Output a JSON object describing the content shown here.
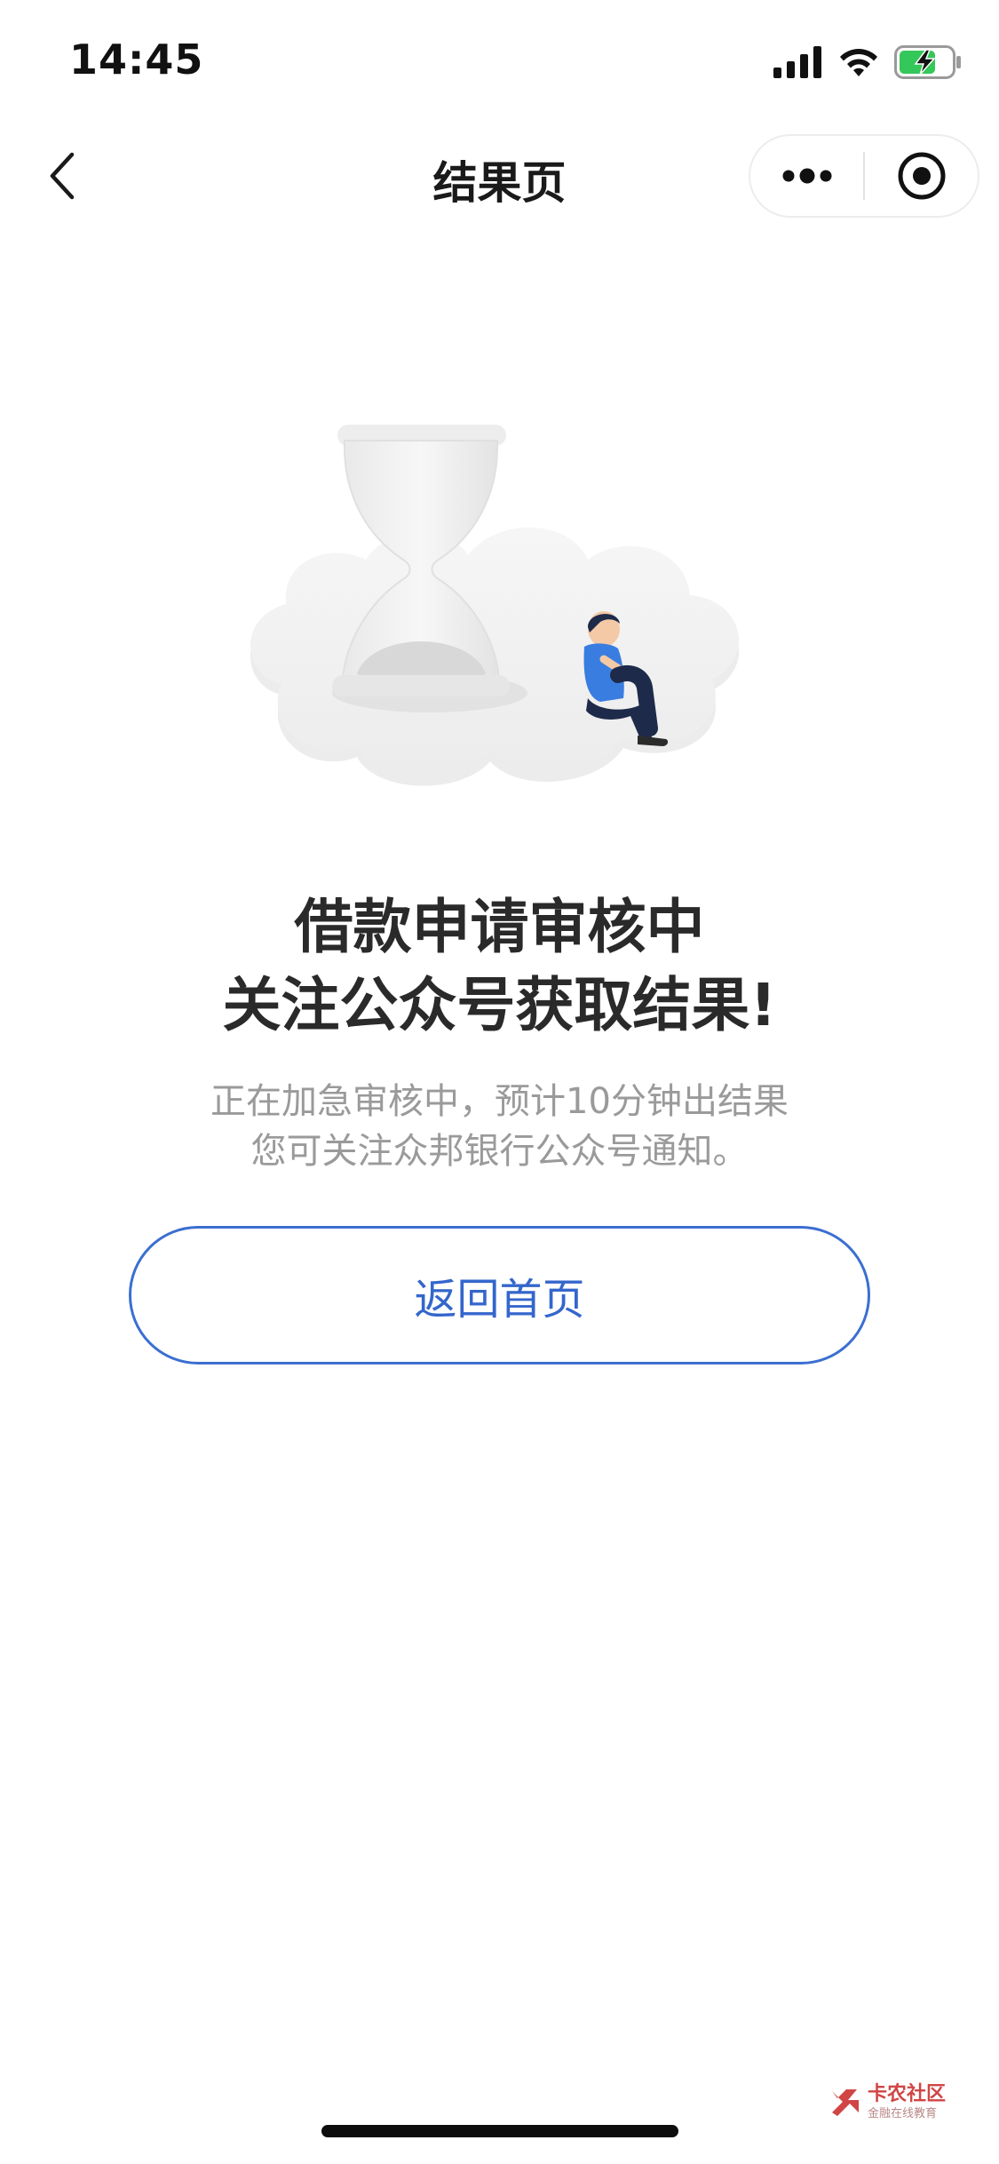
{
  "status_bar": {
    "time": "14:45",
    "icons": [
      "cellular-signal-icon",
      "wifi-icon",
      "battery-charging-icon"
    ]
  },
  "nav": {
    "title": "结果页",
    "back_icon": "chevron-left-icon",
    "more_icon": "more-dots-icon",
    "close_icon": "target-close-icon"
  },
  "result": {
    "illustration": "hourglass-waiting-illustration",
    "headline_line1": "借款申请审核中",
    "headline_line2": "关注公众号获取结果!",
    "sub_line1": "正在加急审核中，预计10分钟出结果",
    "sub_line2": "您可关注众邦银行公众号通知。"
  },
  "actions": {
    "home_label": "返回首页"
  },
  "watermark": {
    "title": "卡农社区",
    "subtitle": "金融在线教育"
  },
  "colors": {
    "accent": "#3466cc",
    "headline": "#2a2a2a",
    "subtext": "#9a9a9a",
    "figure_shirt": "#3a7de0",
    "watermark": "#d04545"
  }
}
